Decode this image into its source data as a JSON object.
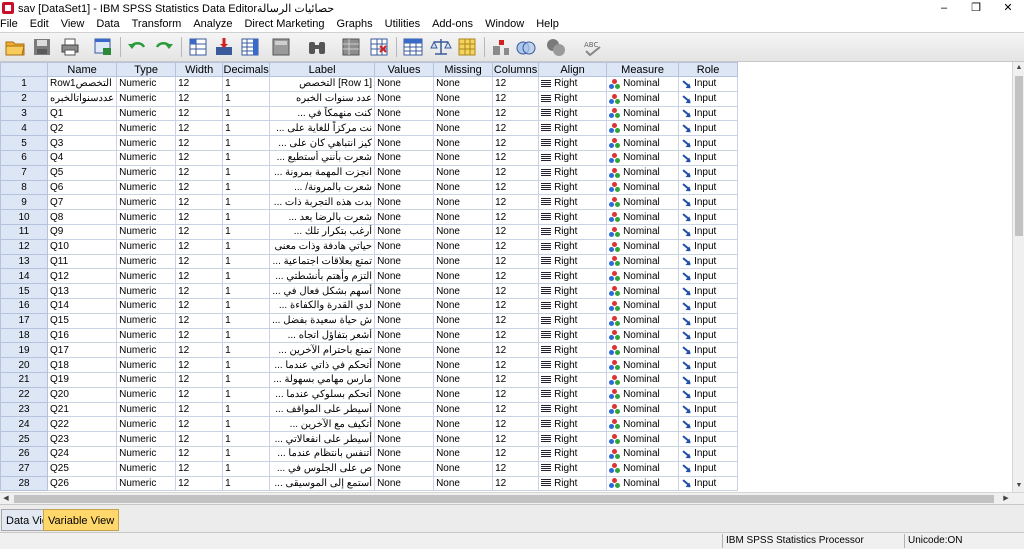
{
  "window": {
    "title": "sav [DataSet1] - IBM SPSS Statistics Data Editorحصائيات الرسالة",
    "minimize": "–",
    "maximize": "❐",
    "close": "✕"
  },
  "menu": [
    "File",
    "Edit",
    "View",
    "Data",
    "Transform",
    "Analyze",
    "Direct Marketing",
    "Graphs",
    "Utilities",
    "Add-ons",
    "Window",
    "Help"
  ],
  "toolbar": {
    "icons": [
      "open-folder-icon",
      "save-icon",
      "print-icon",
      "dialog-recall-icon",
      "undo-icon",
      "redo-icon",
      "goto-case-icon",
      "goto-variable-icon",
      "variables-icon",
      "run-descriptives-icon",
      "find-icon",
      "insert-cases-icon",
      "insert-variable-icon",
      "split-file-icon",
      "weight-cases-icon",
      "select-cases-icon",
      "value-labels-icon",
      "use-sets-icon",
      "show-all-variables-icon",
      "spell-check-icon"
    ]
  },
  "grid": {
    "columns": [
      "Name",
      "Type",
      "Width",
      "Decimals",
      "Label",
      "Values",
      "Missing",
      "Columns",
      "Align",
      "Measure",
      "Role"
    ],
    "rows": [
      {
        "num": "1",
        "name": "Row1التخصص",
        "type": "Numeric",
        "width": "12",
        "decimals": "1",
        "label": "[Row 1] التخصص",
        "values": "None",
        "missing": "None",
        "columns": "12",
        "align": "Right",
        "measure": "Nominal",
        "role": "Input"
      },
      {
        "num": "2",
        "name": "عددسنواتالخبره",
        "type": "Numeric",
        "width": "12",
        "decimals": "1",
        "label": "عدد سنوات الخبره",
        "values": "None",
        "missing": "None",
        "columns": "12",
        "align": "Right",
        "measure": "Nominal",
        "role": "Input"
      },
      {
        "num": "3",
        "name": "Q1",
        "type": "Numeric",
        "width": "12",
        "decimals": "1",
        "label": "كنت منهمكاً في ...",
        "values": "None",
        "missing": "None",
        "columns": "12",
        "align": "Right",
        "measure": "Nominal",
        "role": "Input"
      },
      {
        "num": "4",
        "name": "Q2",
        "type": "Numeric",
        "width": "12",
        "decimals": "1",
        "label": "نت مركزاً للغاية على ...",
        "values": "None",
        "missing": "None",
        "columns": "12",
        "align": "Right",
        "measure": "Nominal",
        "role": "Input"
      },
      {
        "num": "5",
        "name": "Q3",
        "type": "Numeric",
        "width": "12",
        "decimals": "1",
        "label": "كيز انتباهي كان على ...",
        "values": "None",
        "missing": "None",
        "columns": "12",
        "align": "Right",
        "measure": "Nominal",
        "role": "Input"
      },
      {
        "num": "6",
        "name": "Q4",
        "type": "Numeric",
        "width": "12",
        "decimals": "1",
        "label": "شعرت بأنني أستطيع ...",
        "values": "None",
        "missing": "None",
        "columns": "12",
        "align": "Right",
        "measure": "Nominal",
        "role": "Input"
      },
      {
        "num": "7",
        "name": "Q5",
        "type": "Numeric",
        "width": "12",
        "decimals": "1",
        "label": "انجزت المهمة بمرونة ...",
        "values": "None",
        "missing": "None",
        "columns": "12",
        "align": "Right",
        "measure": "Nominal",
        "role": "Input"
      },
      {
        "num": "8",
        "name": "Q6",
        "type": "Numeric",
        "width": "12",
        "decimals": "1",
        "label": "شعرت بالمرونة/ ...",
        "values": "None",
        "missing": "None",
        "columns": "12",
        "align": "Right",
        "measure": "Nominal",
        "role": "Input"
      },
      {
        "num": "9",
        "name": "Q7",
        "type": "Numeric",
        "width": "12",
        "decimals": "1",
        "label": "بدت هذه التجربة ذات ...",
        "values": "None",
        "missing": "None",
        "columns": "12",
        "align": "Right",
        "measure": "Nominal",
        "role": "Input"
      },
      {
        "num": "10",
        "name": "Q8",
        "type": "Numeric",
        "width": "12",
        "decimals": "1",
        "label": "شعرت بالرضا بعد ...",
        "values": "None",
        "missing": "None",
        "columns": "12",
        "align": "Right",
        "measure": "Nominal",
        "role": "Input"
      },
      {
        "num": "11",
        "name": "Q9",
        "type": "Numeric",
        "width": "12",
        "decimals": "1",
        "label": "أرغب بتكرار تلك ...",
        "values": "None",
        "missing": "None",
        "columns": "12",
        "align": "Right",
        "measure": "Nominal",
        "role": "Input"
      },
      {
        "num": "12",
        "name": "Q10",
        "type": "Numeric",
        "width": "12",
        "decimals": "1",
        "label": "حياتي هادفة وذات معنى",
        "values": "None",
        "missing": "None",
        "columns": "12",
        "align": "Right",
        "measure": "Nominal",
        "role": "Input"
      },
      {
        "num": "13",
        "name": "Q11",
        "type": "Numeric",
        "width": "12",
        "decimals": "1",
        "label": "تمتع بعلاقات اجتماعية ...",
        "values": "None",
        "missing": "None",
        "columns": "12",
        "align": "Right",
        "measure": "Nominal",
        "role": "Input"
      },
      {
        "num": "14",
        "name": "Q12",
        "type": "Numeric",
        "width": "12",
        "decimals": "1",
        "label": "التزم وأهتم بأنشطتي ...",
        "values": "None",
        "missing": "None",
        "columns": "12",
        "align": "Right",
        "measure": "Nominal",
        "role": "Input"
      },
      {
        "num": "15",
        "name": "Q13",
        "type": "Numeric",
        "width": "12",
        "decimals": "1",
        "label": "أسهم بشكل فعال في ...",
        "values": "None",
        "missing": "None",
        "columns": "12",
        "align": "Right",
        "measure": "Nominal",
        "role": "Input"
      },
      {
        "num": "16",
        "name": "Q14",
        "type": "Numeric",
        "width": "12",
        "decimals": "1",
        "label": "لدي القدرة والكفاءة ...",
        "values": "None",
        "missing": "None",
        "columns": "12",
        "align": "Right",
        "measure": "Nominal",
        "role": "Input"
      },
      {
        "num": "17",
        "name": "Q15",
        "type": "Numeric",
        "width": "12",
        "decimals": "1",
        "label": "ش حياة سعيدة بفضل ...",
        "values": "None",
        "missing": "None",
        "columns": "12",
        "align": "Right",
        "measure": "Nominal",
        "role": "Input"
      },
      {
        "num": "18",
        "name": "Q16",
        "type": "Numeric",
        "width": "12",
        "decimals": "1",
        "label": "أشعر بتفاؤل اتجاه ...",
        "values": "None",
        "missing": "None",
        "columns": "12",
        "align": "Right",
        "measure": "Nominal",
        "role": "Input"
      },
      {
        "num": "19",
        "name": "Q17",
        "type": "Numeric",
        "width": "12",
        "decimals": "1",
        "label": "تمتع باحترام الآخرين ...",
        "values": "None",
        "missing": "None",
        "columns": "12",
        "align": "Right",
        "measure": "Nominal",
        "role": "Input"
      },
      {
        "num": "20",
        "name": "Q18",
        "type": "Numeric",
        "width": "12",
        "decimals": "1",
        "label": "أتحكم في ذاتي عندما ...",
        "values": "None",
        "missing": "None",
        "columns": "12",
        "align": "Right",
        "measure": "Nominal",
        "role": "Input"
      },
      {
        "num": "21",
        "name": "Q19",
        "type": "Numeric",
        "width": "12",
        "decimals": "1",
        "label": "مارس مهامي بسهولة ...",
        "values": "None",
        "missing": "None",
        "columns": "12",
        "align": "Right",
        "measure": "Nominal",
        "role": "Input"
      },
      {
        "num": "22",
        "name": "Q20",
        "type": "Numeric",
        "width": "12",
        "decimals": "1",
        "label": "أتحكم بسلوكي عندما ...",
        "values": "None",
        "missing": "None",
        "columns": "12",
        "align": "Right",
        "measure": "Nominal",
        "role": "Input"
      },
      {
        "num": "23",
        "name": "Q21",
        "type": "Numeric",
        "width": "12",
        "decimals": "1",
        "label": "أسيطر على المواقف ...",
        "values": "None",
        "missing": "None",
        "columns": "12",
        "align": "Right",
        "measure": "Nominal",
        "role": "Input"
      },
      {
        "num": "24",
        "name": "Q22",
        "type": "Numeric",
        "width": "12",
        "decimals": "1",
        "label": "أتكيف مع الآخرين ...",
        "values": "None",
        "missing": "None",
        "columns": "12",
        "align": "Right",
        "measure": "Nominal",
        "role": "Input"
      },
      {
        "num": "25",
        "name": "Q23",
        "type": "Numeric",
        "width": "12",
        "decimals": "1",
        "label": "أسيطر على انفعالاتي ...",
        "values": "None",
        "missing": "None",
        "columns": "12",
        "align": "Right",
        "measure": "Nominal",
        "role": "Input"
      },
      {
        "num": "26",
        "name": "Q24",
        "type": "Numeric",
        "width": "12",
        "decimals": "1",
        "label": "أتنفس بانتظام عندما ...",
        "values": "None",
        "missing": "None",
        "columns": "12",
        "align": "Right",
        "measure": "Nominal",
        "role": "Input"
      },
      {
        "num": "27",
        "name": "Q25",
        "type": "Numeric",
        "width": "12",
        "decimals": "1",
        "label": "ص على الجلوس في ...",
        "values": "None",
        "missing": "None",
        "columns": "12",
        "align": "Right",
        "measure": "Nominal",
        "role": "Input"
      },
      {
        "num": "28",
        "name": "Q26",
        "type": "Numeric",
        "width": "12",
        "decimals": "1",
        "label": "أستمع إلى الموسيقى ...",
        "values": "None",
        "missing": "None",
        "columns": "12",
        "align": "Right",
        "measure": "Nominal",
        "role": "Input"
      }
    ]
  },
  "tabs": {
    "data_view": "Data View",
    "variable_view": "Variable View"
  },
  "status": {
    "processor": "IBM SPSS Statistics Processor is ready",
    "unicode": "Unicode:ON"
  }
}
